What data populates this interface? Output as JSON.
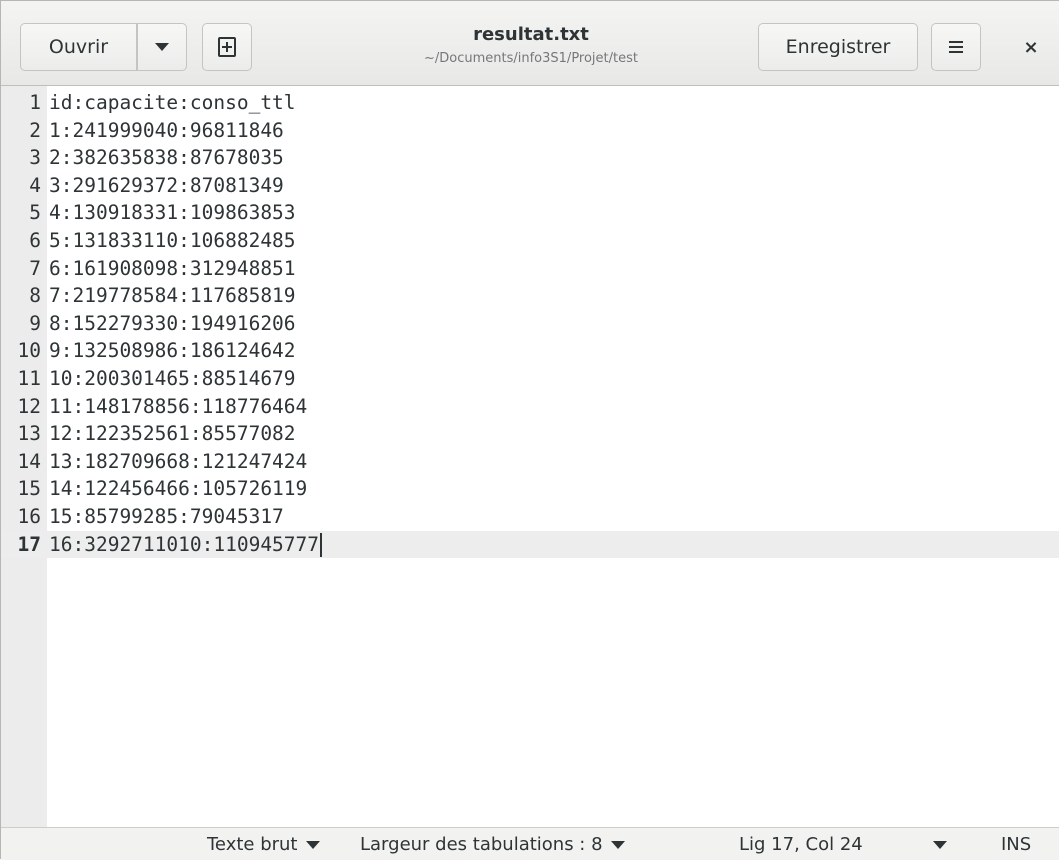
{
  "header": {
    "open_label": "Ouvrir",
    "open_menu_icon": "chevron-down-icon",
    "new_document_icon": "new-document-icon",
    "title": "resultat.txt",
    "subtitle": "~/Documents/info3S1/Projet/test",
    "save_label": "Enregistrer",
    "menu_icon": "hamburger-menu-icon",
    "close_glyph": "×"
  },
  "editor": {
    "lines": [
      {
        "n": "1",
        "text": "id:capacite:conso_ttl"
      },
      {
        "n": "2",
        "text": "1:241999040:96811846"
      },
      {
        "n": "3",
        "text": "2:382635838:87678035"
      },
      {
        "n": "4",
        "text": "3:291629372:87081349"
      },
      {
        "n": "5",
        "text": "4:130918331:109863853"
      },
      {
        "n": "6",
        "text": "5:131833110:106882485"
      },
      {
        "n": "7",
        "text": "6:161908098:312948851"
      },
      {
        "n": "8",
        "text": "7:219778584:117685819"
      },
      {
        "n": "9",
        "text": "8:152279330:194916206"
      },
      {
        "n": "10",
        "text": "9:132508986:186124642"
      },
      {
        "n": "11",
        "text": "10:200301465:88514679"
      },
      {
        "n": "12",
        "text": "11:148178856:118776464"
      },
      {
        "n": "13",
        "text": "12:122352561:85577082"
      },
      {
        "n": "14",
        "text": "13:182709668:121247424"
      },
      {
        "n": "15",
        "text": "14:122456466:105726119"
      },
      {
        "n": "16",
        "text": "15:85799285:79045317"
      },
      {
        "n": "17",
        "text": "16:3292711010:110945777"
      }
    ]
  },
  "statusbar": {
    "syntax_label": "Texte brut",
    "tab_width_label": "Largeur des tabulations : 8",
    "position_label": "Lig 17, Col 24",
    "insert_mode": "INS"
  }
}
